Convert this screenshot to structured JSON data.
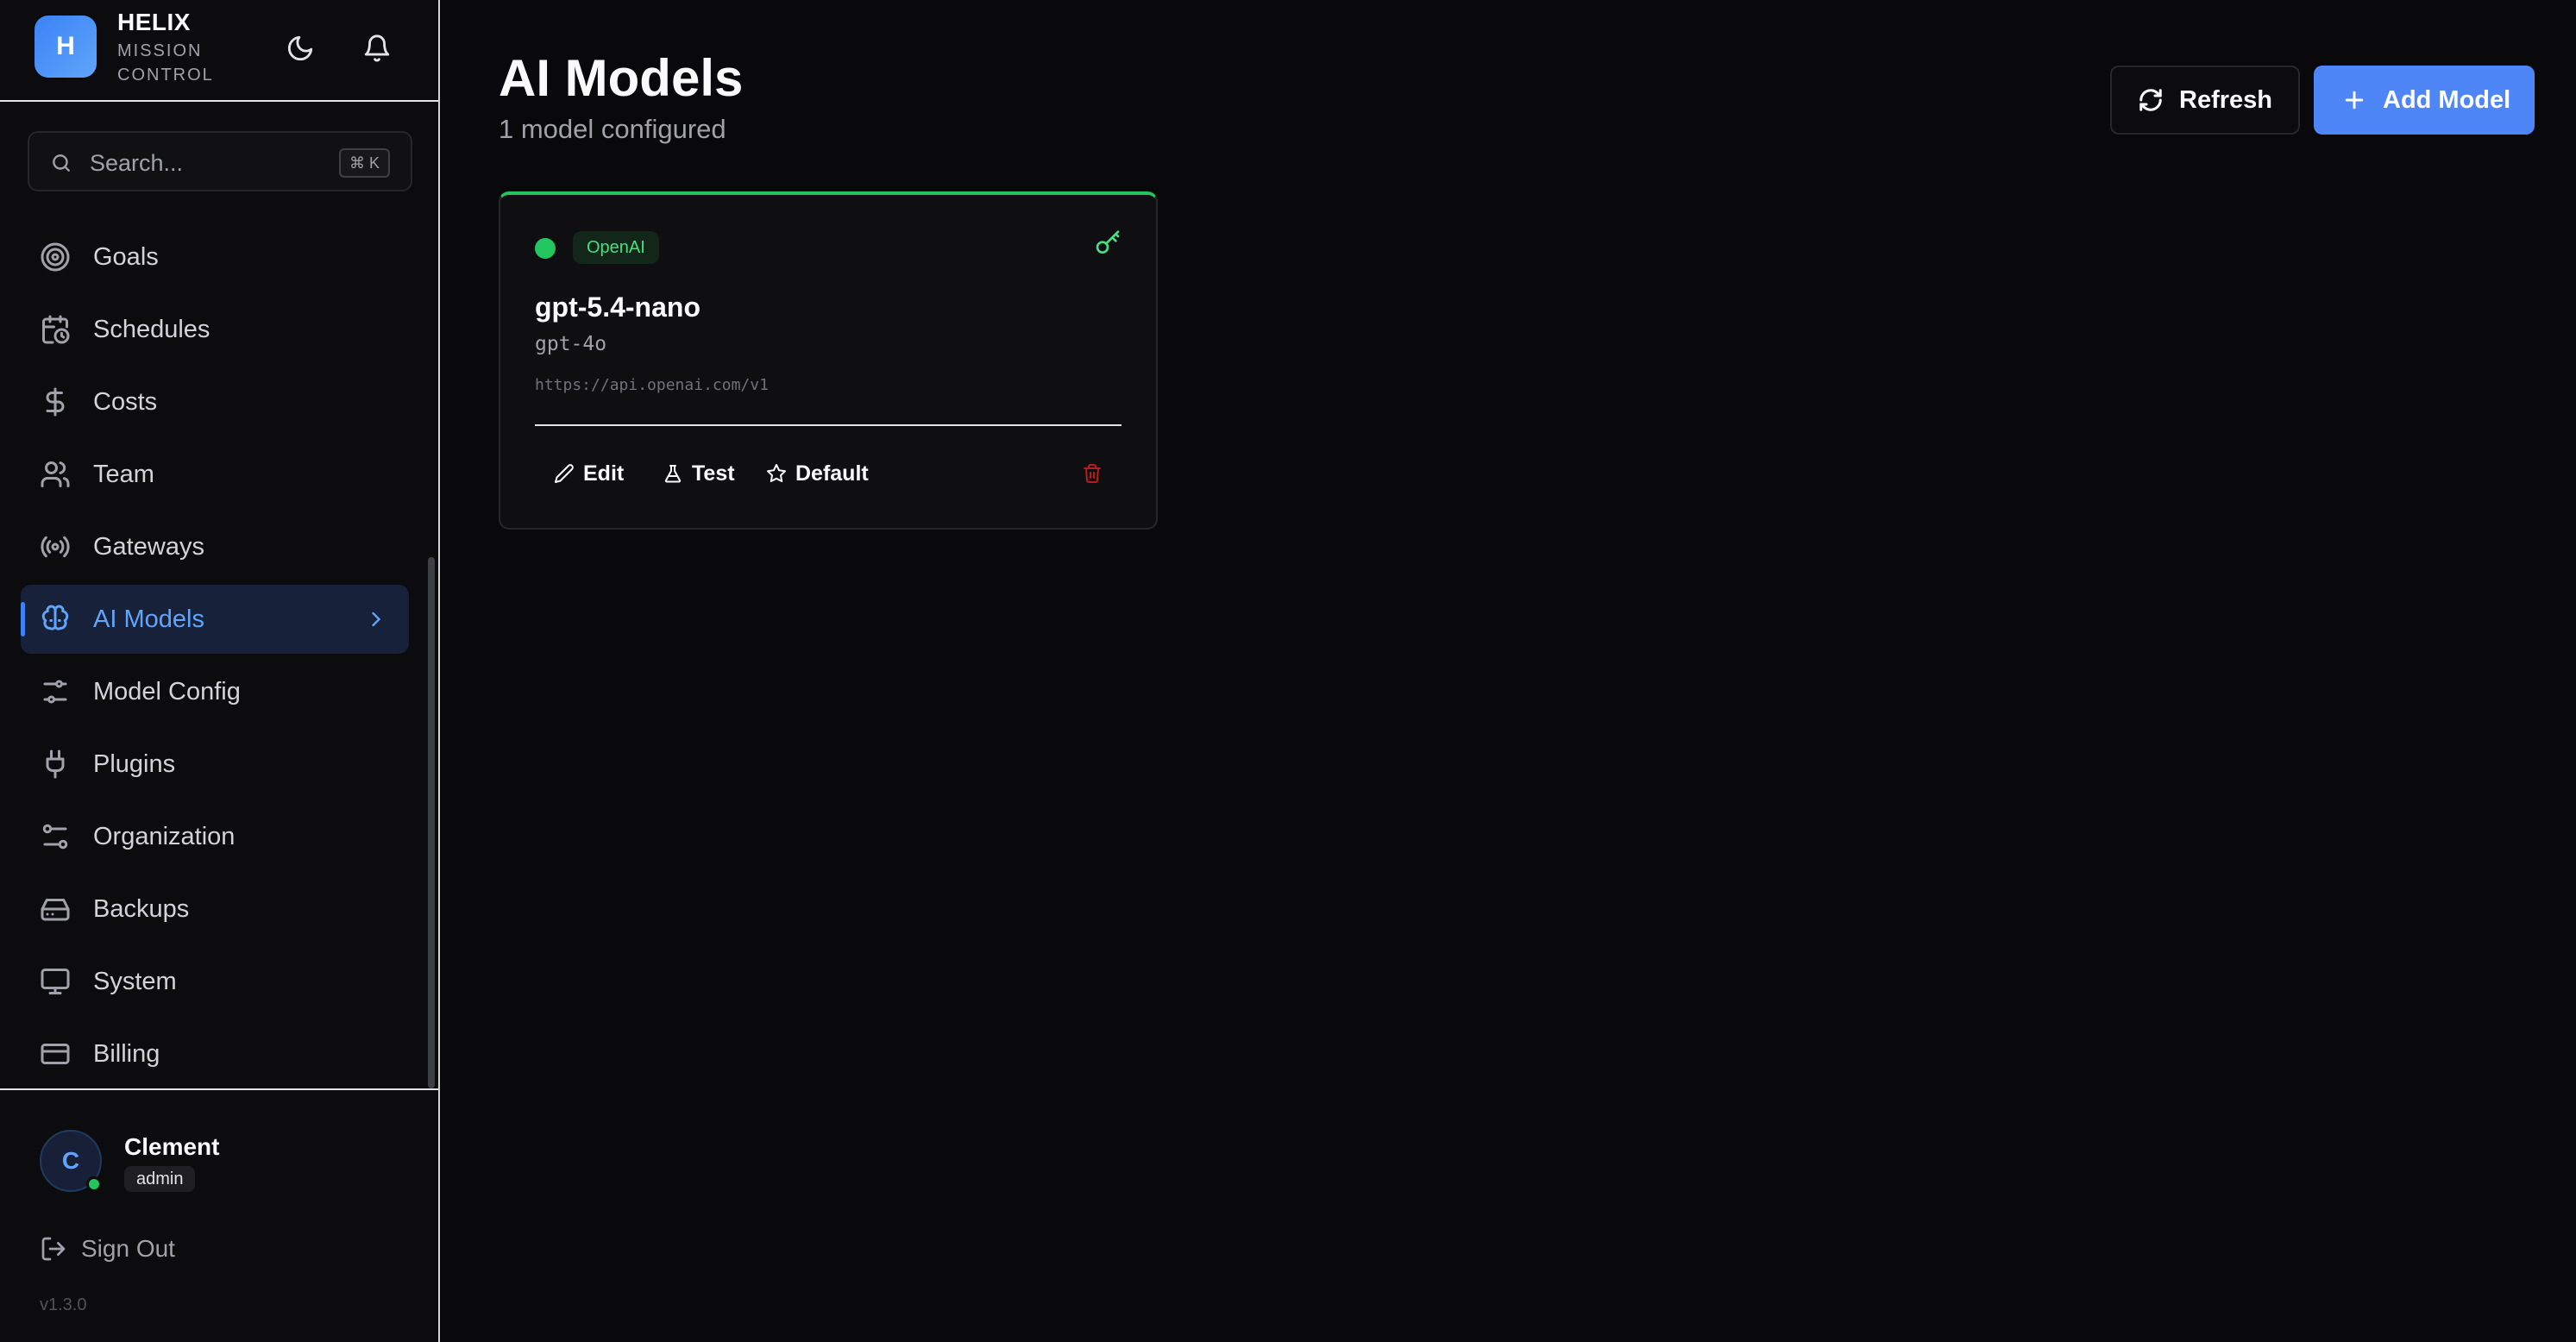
{
  "brand": {
    "logo_letter": "H",
    "name": "HELIX",
    "subtitle_line1": "MISSION",
    "subtitle_line2": "CONTROL"
  },
  "header_icons": [
    "moon-icon",
    "bell-icon"
  ],
  "search": {
    "placeholder": "Search...",
    "shortcut": "⌘ K"
  },
  "sidebar": {
    "items": [
      {
        "label": "Goals",
        "icon": "target-icon",
        "active": false
      },
      {
        "label": "Schedules",
        "icon": "calendar-clock-icon",
        "active": false
      },
      {
        "label": "Costs",
        "icon": "dollar-icon",
        "active": false
      },
      {
        "label": "Team",
        "icon": "users-icon",
        "active": false
      },
      {
        "label": "Gateways",
        "icon": "radio-icon",
        "active": false
      },
      {
        "label": "AI Models",
        "icon": "brain-icon",
        "active": true
      },
      {
        "label": "Model Config",
        "icon": "sliders-icon",
        "active": false
      },
      {
        "label": "Plugins",
        "icon": "plug-icon",
        "active": false
      },
      {
        "label": "Organization",
        "icon": "settings-sliders-icon",
        "active": false
      },
      {
        "label": "Backups",
        "icon": "hard-drive-icon",
        "active": false
      },
      {
        "label": "System",
        "icon": "monitor-icon",
        "active": false
      },
      {
        "label": "Billing",
        "icon": "credit-card-icon",
        "active": false
      }
    ]
  },
  "user": {
    "initial": "C",
    "name": "Clement",
    "role": "admin",
    "status": "online"
  },
  "sign_out_label": "Sign Out",
  "version": "v1.3.0",
  "main": {
    "title": "AI Models",
    "subtitle": "1 model configured",
    "refresh_label": "Refresh",
    "add_label": "Add Model"
  },
  "models": [
    {
      "provider": "OpenAI",
      "name": "gpt-5.4-nano",
      "model_id": "gpt-4o",
      "base_url": "https://api.openai.com/v1",
      "status_color": "#22c55e",
      "actions": {
        "edit": "Edit",
        "test": "Test",
        "default": "Default"
      }
    }
  ],
  "colors": {
    "accent": "#3b82f6",
    "success": "#22c55e",
    "danger": "#b91c1c",
    "background": "#09090b"
  }
}
